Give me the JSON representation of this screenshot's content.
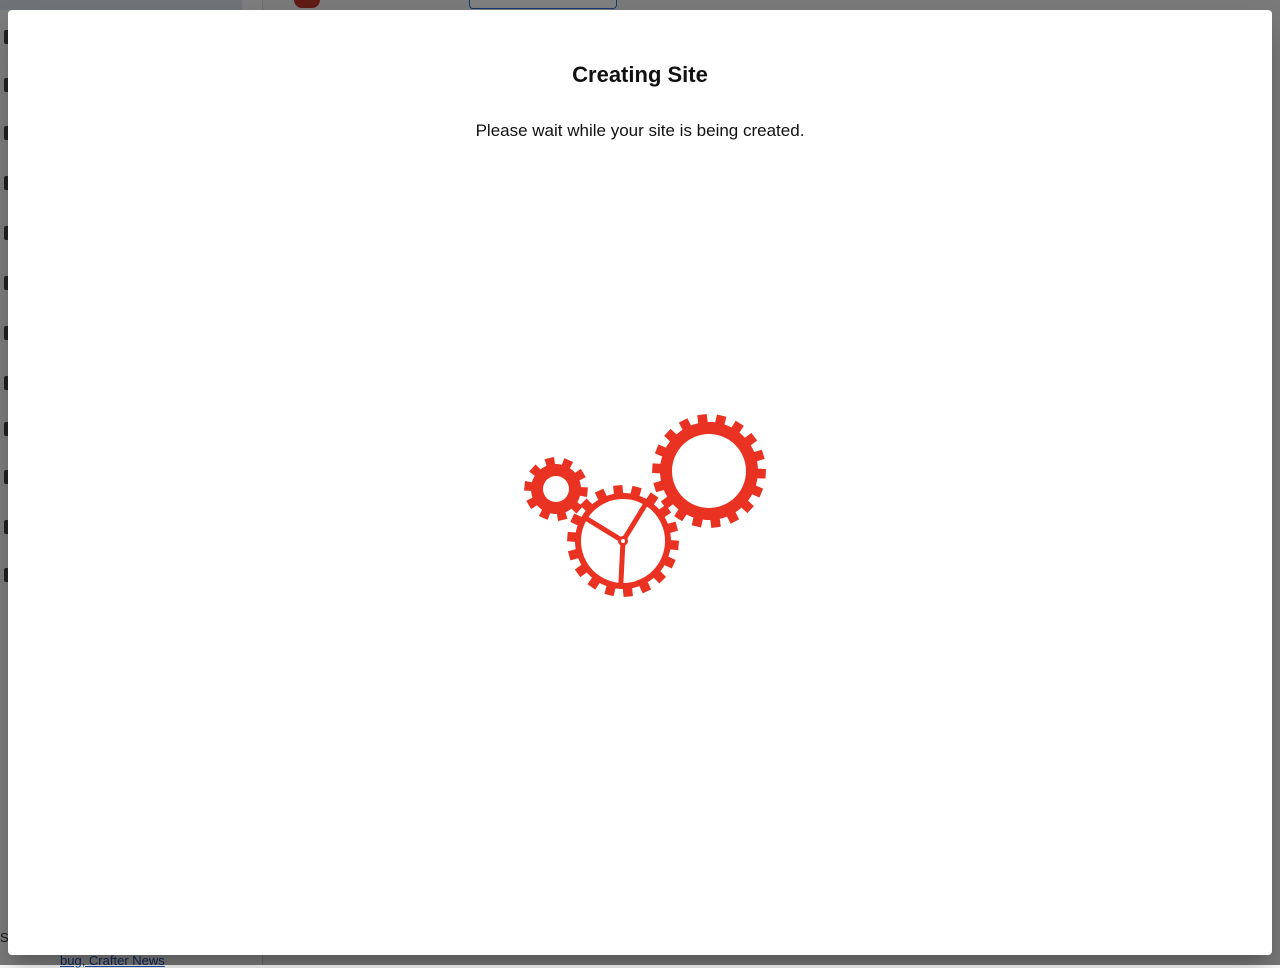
{
  "dialog": {
    "title": "Creating Site",
    "message": "Please wait while your site is being created."
  },
  "loader": {
    "icon": "gears-icon",
    "color": "#ea3223"
  },
  "background": {
    "footer_link": "bug, Crafter News",
    "footer_char": "S"
  }
}
